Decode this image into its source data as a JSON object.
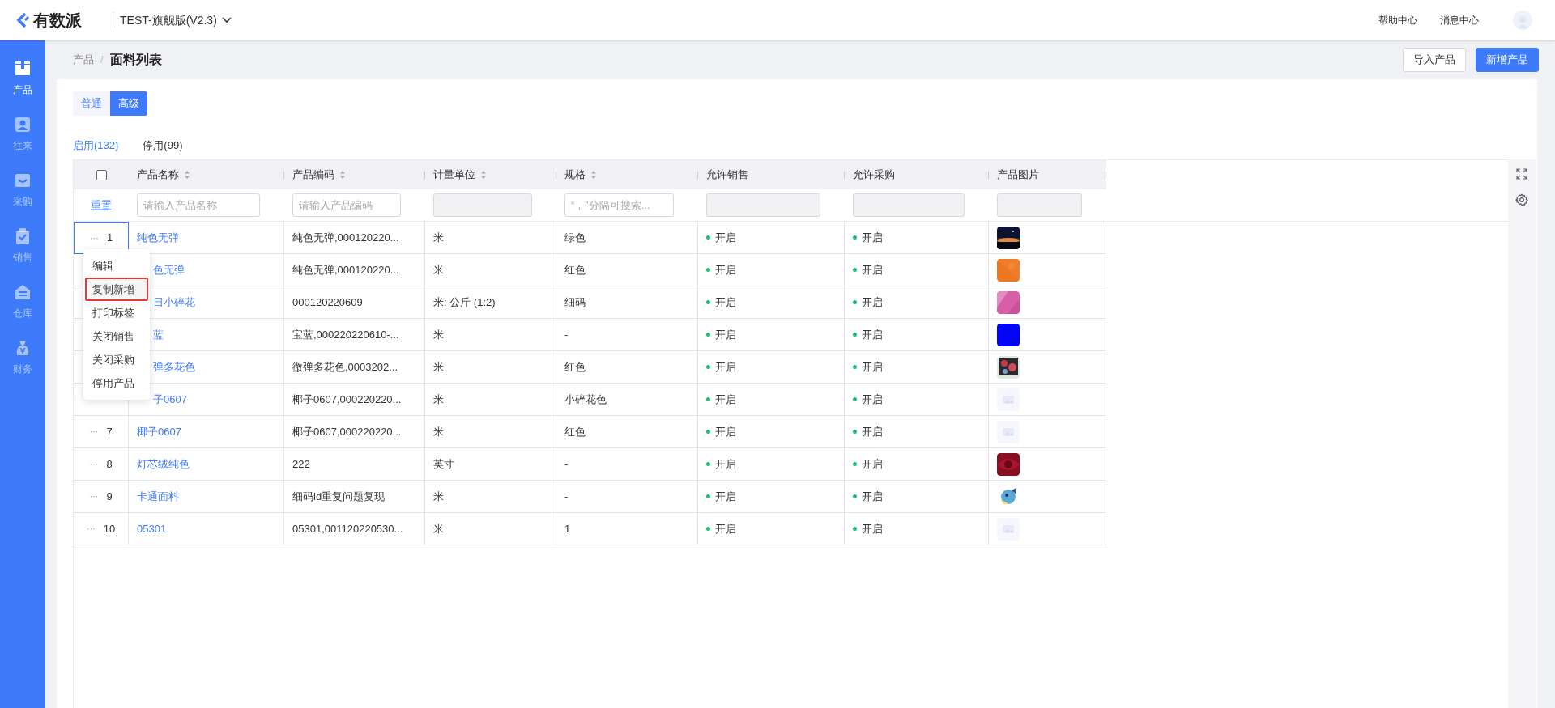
{
  "topbar": {
    "logo": "有数派",
    "workspace": "TEST-旗舰版(V2.3)",
    "links": [
      "帮助中心",
      "消息中心"
    ]
  },
  "sidebar": {
    "items": [
      {
        "label": "产品",
        "selected": true
      },
      {
        "label": "往来",
        "selected": false
      },
      {
        "label": "采购",
        "selected": false
      },
      {
        "label": "销售",
        "selected": false
      },
      {
        "label": "仓库",
        "selected": false
      },
      {
        "label": "财务",
        "selected": false
      }
    ]
  },
  "breadcrumb": {
    "parent": "产品",
    "separator": "/",
    "current": "面料列表"
  },
  "actions": [
    {
      "label": "导入产品",
      "primary": false
    },
    {
      "label": "新增产品",
      "primary": true
    }
  ],
  "mode_toggle": [
    {
      "label": "普通",
      "selected": false
    },
    {
      "label": "高级",
      "selected": true
    }
  ],
  "status_tabs": [
    {
      "label": "启用(132)",
      "selected": true
    },
    {
      "label": "停用(99)",
      "selected": false
    }
  ],
  "table": {
    "columns": [
      {
        "label": "产品名称",
        "sortable": true
      },
      {
        "label": "产品编码",
        "sortable": true
      },
      {
        "label": "计量单位",
        "sortable": true
      },
      {
        "label": "规格",
        "sortable": true
      },
      {
        "label": "允许销售",
        "sortable": false
      },
      {
        "label": "允许采购",
        "sortable": false
      },
      {
        "label": "产品图片",
        "sortable": false
      }
    ],
    "select_all": {
      "checked": false
    },
    "reset": "重置",
    "filters": [
      {
        "placeholder": "请输入产品名称",
        "disabled": false
      },
      {
        "placeholder": "请输入产品编码",
        "disabled": false
      },
      {
        "disabled": true
      },
      {
        "placeholder": "“，”分隔可搜索...",
        "disabled": false
      },
      {
        "disabled": true
      },
      {
        "disabled": true
      },
      {
        "disabled": true
      }
    ],
    "rows": [
      {
        "more": "···",
        "index": "1",
        "selected": true,
        "name": "纯色无弹",
        "code": "纯色无弹,000120220...",
        "unit": "米",
        "spec": "绿色",
        "sale": {
          "label": "开启",
          "on": true
        },
        "purchase": {
          "label": "开启",
          "on": true
        }
      },
      {
        "name": "色无弹",
        "selected": false,
        "code": "纯色无弹,000120220...",
        "unit": "米",
        "spec": "红色",
        "sale": {
          "label": "开启",
          "on": true
        },
        "purchase": {
          "label": "开启",
          "on": true
        }
      },
      {
        "name": "日小碎花",
        "selected": false,
        "code": "000120220609",
        "unit": "米: 公斤 (1:2)",
        "spec": "细码",
        "sale": {
          "label": "开启",
          "on": true
        },
        "purchase": {
          "label": "开启",
          "on": true
        }
      },
      {
        "name": "蓝",
        "selected": false,
        "code": "宝蓝,000220220610-...",
        "unit": "米",
        "spec": "-",
        "sale": {
          "label": "开启",
          "on": true
        },
        "purchase": {
          "label": "开启",
          "on": true
        }
      },
      {
        "name": "弹多花色",
        "selected": false,
        "code": "微弹多花色,0003202...",
        "unit": "米",
        "spec": "红色",
        "sale": {
          "label": "开启",
          "on": true
        },
        "purchase": {
          "label": "开启",
          "on": true
        }
      },
      {
        "name": "子0607",
        "selected": false,
        "code": "椰子0607,000220220...",
        "unit": "米",
        "spec": "小碎花色",
        "sale": {
          "label": "开启",
          "on": true
        },
        "purchase": {
          "label": "开启",
          "on": true
        },
        "image": {
          "kind": "placeholder"
        }
      },
      {
        "more": "···",
        "index": "7",
        "selected": false,
        "name": "椰子0607",
        "code": "椰子0607,000220220...",
        "unit": "米",
        "spec": "红色",
        "sale": {
          "label": "开启",
          "on": true
        },
        "purchase": {
          "label": "开启",
          "on": true
        },
        "image": {
          "kind": "placeholder"
        }
      },
      {
        "more": "···",
        "index": "8",
        "selected": false,
        "name": "灯芯绒纯色",
        "code": "222",
        "unit": "英寸",
        "spec": "-",
        "sale": {
          "label": "开启",
          "on": true
        },
        "purchase": {
          "label": "开启",
          "on": true
        }
      },
      {
        "more": "···",
        "index": "9",
        "selected": false,
        "name": "卡通面料",
        "code": "细码id重复问题复现",
        "unit": "米",
        "spec": "-",
        "sale": {
          "label": "开启",
          "on": true
        },
        "purchase": {
          "label": "开启",
          "on": true
        }
      },
      {
        "more": "···",
        "index": "10",
        "selected": false,
        "name": "05301",
        "code": "05301,001120220530...",
        "unit": "米",
        "spec": "1",
        "sale": {
          "label": "开启",
          "on": true
        },
        "purchase": {
          "label": "开启",
          "on": true
        },
        "image": {
          "kind": "placeholder"
        }
      }
    ]
  },
  "row_menu": {
    "items": [
      {
        "label": "编辑",
        "highlighted": false
      },
      {
        "label": "复制新增",
        "highlighted": true
      },
      {
        "label": "打印标签",
        "highlighted": false
      },
      {
        "label": "关闭销售",
        "highlighted": false
      },
      {
        "label": "关闭采购",
        "highlighted": false
      },
      {
        "label": "停用产品",
        "highlighted": false
      }
    ]
  }
}
